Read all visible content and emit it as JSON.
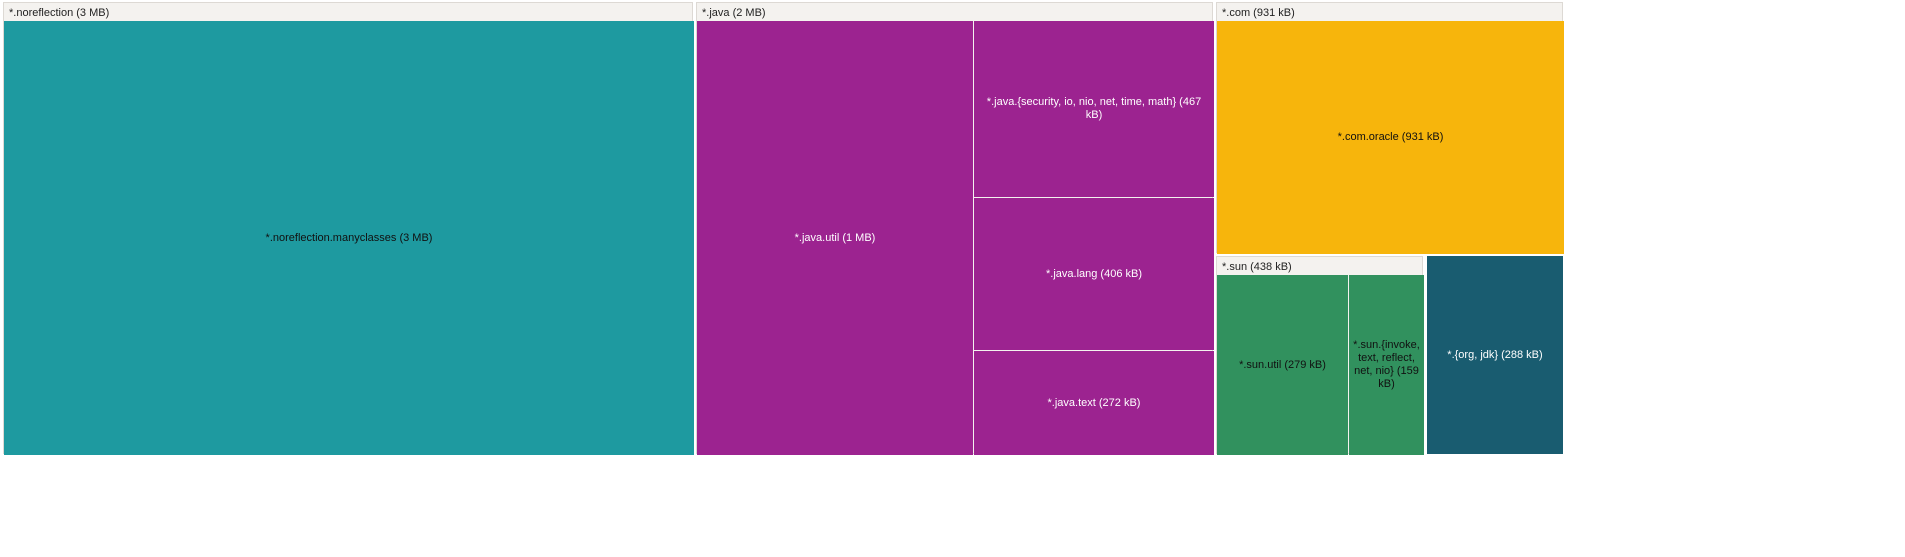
{
  "colors": {
    "teal": "#1e9aa0",
    "magenta": "#9c2390",
    "gold": "#f7b50c",
    "green": "#31915e",
    "darkteal": "#195c70"
  },
  "groups": {
    "noreflection": {
      "header": "*.noreflection (3 MB)",
      "cells": {
        "manyclasses": "*.noreflection.manyclasses (3 MB)"
      }
    },
    "java": {
      "header": "*.java (2 MB)",
      "cells": {
        "util": "*.java.util (1 MB)",
        "misc": "*.java.{security, io, nio, net, time, math} (467 kB)",
        "lang": "*.java.lang (406 kB)",
        "text": "*.java.text (272 kB)"
      }
    },
    "com": {
      "header": "*.com (931 kB)",
      "cells": {
        "oracle": "*.com.oracle (931 kB)"
      }
    },
    "sun": {
      "header": "*.sun (438 kB)",
      "cells": {
        "util": "*.sun.util (279 kB)",
        "misc": "*.sun.{invoke, text, reflect, net, nio} (159 kB)"
      }
    },
    "orgjdk": {
      "label": "*.{org, jdk} (288 kB)"
    }
  }
}
